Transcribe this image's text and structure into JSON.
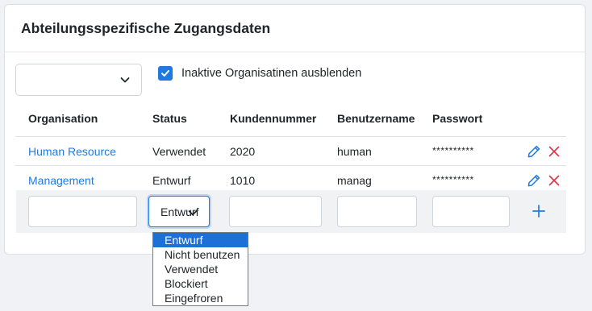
{
  "card": {
    "title": "Abteilungsspezifische Zugangsdaten"
  },
  "filter": {
    "select_value": "",
    "checkbox_label": "Inaktive Organisatinen ausblenden",
    "checkbox_checked": true
  },
  "table": {
    "columns": [
      "Organisation",
      "Status",
      "Kundennummer",
      "Benutzername",
      "Passwort"
    ],
    "rows": [
      {
        "organisation": "Human Resource",
        "status": "Verwendet",
        "kundennummer": "2020",
        "benutzername": "human",
        "passwort": "**********"
      },
      {
        "organisation": "Management",
        "status": "Entwurf",
        "kundennummer": "1010",
        "benutzername": "manag",
        "passwort": "**********"
      }
    ]
  },
  "new_row": {
    "organisation": "",
    "status_value": "Entwurf",
    "kundennummer": "",
    "benutzername": "",
    "passwort": ""
  },
  "status_dropdown": {
    "options": [
      "Entwurf",
      "Nicht benutzen",
      "Verwendet",
      "Blockiert",
      "Eingefroren"
    ],
    "selected": "Entwurf"
  },
  "colors": {
    "accent": "#1f7ae0",
    "danger": "#dc3545",
    "selected_option": "#1f6fd8"
  },
  "icons": {
    "edit": "pencil-icon",
    "delete": "close-icon",
    "add": "plus-icon",
    "select": "chevron-down-icon",
    "check": "check-icon"
  }
}
